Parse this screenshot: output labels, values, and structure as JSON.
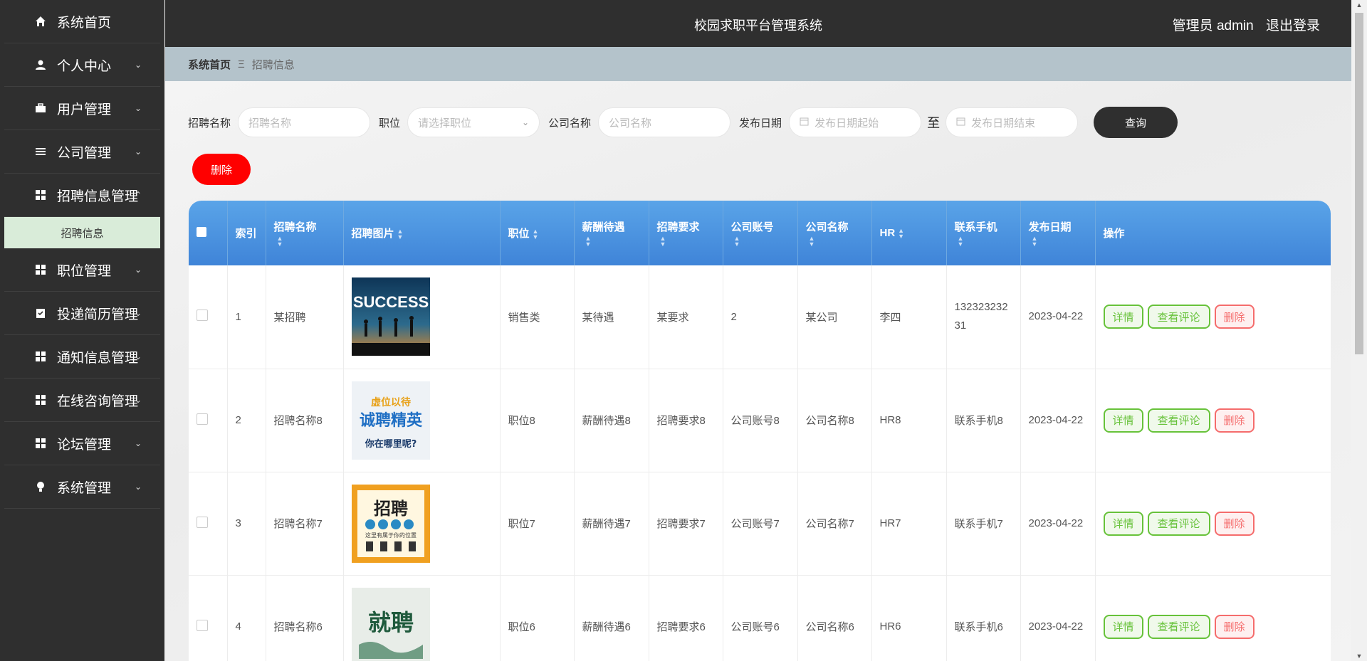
{
  "sidebar": {
    "items": [
      {
        "label": "系统首页",
        "icon": "home-icon",
        "chev": ""
      },
      {
        "label": "个人中心",
        "icon": "user-icon",
        "chev": "⌄"
      },
      {
        "label": "用户管理",
        "icon": "briefcase-icon",
        "chev": "⌄"
      },
      {
        "label": "公司管理",
        "icon": "list-icon",
        "chev": "⌄"
      },
      {
        "label": "招聘信息管理",
        "icon": "grid-icon",
        "chev": "⌃"
      },
      {
        "label": "职位管理",
        "icon": "grid-icon",
        "chev": "⌄"
      },
      {
        "label": "投递简历管理",
        "icon": "clipboard-icon",
        "chev": "⌄"
      },
      {
        "label": "通知信息管理",
        "icon": "grid-icon",
        "chev": "⌄"
      },
      {
        "label": "在线咨询管理",
        "icon": "grid-icon",
        "chev": "⌄"
      },
      {
        "label": "论坛管理",
        "icon": "grid-icon",
        "chev": "⌄"
      },
      {
        "label": "系统管理",
        "icon": "bulb-icon",
        "chev": "⌄"
      }
    ],
    "sub_item": "招聘信息"
  },
  "header": {
    "title": "校园求职平台管理系统",
    "user": "管理员 admin",
    "logout": "退出登录"
  },
  "breadcrumb": {
    "home": "系统首页",
    "sep": "Ξ",
    "current": "招聘信息"
  },
  "search": {
    "name_label": "招聘名称",
    "name_placeholder": "招聘名称",
    "position_label": "职位",
    "position_placeholder": "请选择职位",
    "company_label": "公司名称",
    "company_placeholder": "公司名称",
    "date_label": "发布日期",
    "date_start_placeholder": "发布日期起始",
    "to_label": "至",
    "date_end_placeholder": "发布日期结束",
    "query_button": "查询"
  },
  "delete_button": "删除",
  "table": {
    "headers": [
      "索引",
      "招聘名称",
      "招聘图片",
      "职位",
      "薪酬待遇",
      "招聘要求",
      "公司账号",
      "公司名称",
      "HR",
      "联系手机",
      "发布日期",
      "操作"
    ],
    "rows": [
      {
        "index": "1",
        "name": "某招聘",
        "image": "success",
        "position": "销售类",
        "salary": "某待遇",
        "requirement": "某要求",
        "account": "2",
        "company": "某公司",
        "hr": "李四",
        "phone": "13232323231",
        "date": "2023-04-22"
      },
      {
        "index": "2",
        "name": "招聘名称8",
        "image": "elite",
        "position": "职位8",
        "salary": "薪酬待遇8",
        "requirement": "招聘要求8",
        "account": "公司账号8",
        "company": "公司名称8",
        "hr": "HR8",
        "phone": "联系手机8",
        "date": "2023-04-22"
      },
      {
        "index": "3",
        "name": "招聘名称7",
        "image": "zhaopin",
        "position": "职位7",
        "salary": "薪酬待遇7",
        "requirement": "招聘要求7",
        "account": "公司账号7",
        "company": "公司名称7",
        "hr": "HR7",
        "phone": "联系手机7",
        "date": "2023-04-22"
      },
      {
        "index": "4",
        "name": "招聘名称6",
        "image": "jiupin",
        "position": "职位6",
        "salary": "薪酬待遇6",
        "requirement": "招聘要求6",
        "account": "公司账号6",
        "company": "公司名称6",
        "hr": "HR6",
        "phone": "联系手机6",
        "date": "2023-04-22"
      }
    ],
    "actions": {
      "detail": "详情",
      "comment": "查看评论",
      "delete": "删除"
    }
  },
  "poster_texts": {
    "success": "SUCCESS",
    "elite_top": "虚位以待",
    "elite_mid": "诚聘精英",
    "elite_bottom": "你在哪里呢?",
    "zhaopin": "招聘",
    "zhaopin_sub": "这里有属于你的位置",
    "jiupin": "就聘"
  },
  "colors": {
    "sidebar": "#2f2f2f",
    "accent": "#3f84d8",
    "danger": "#ff0000",
    "success": "#67c23a"
  }
}
